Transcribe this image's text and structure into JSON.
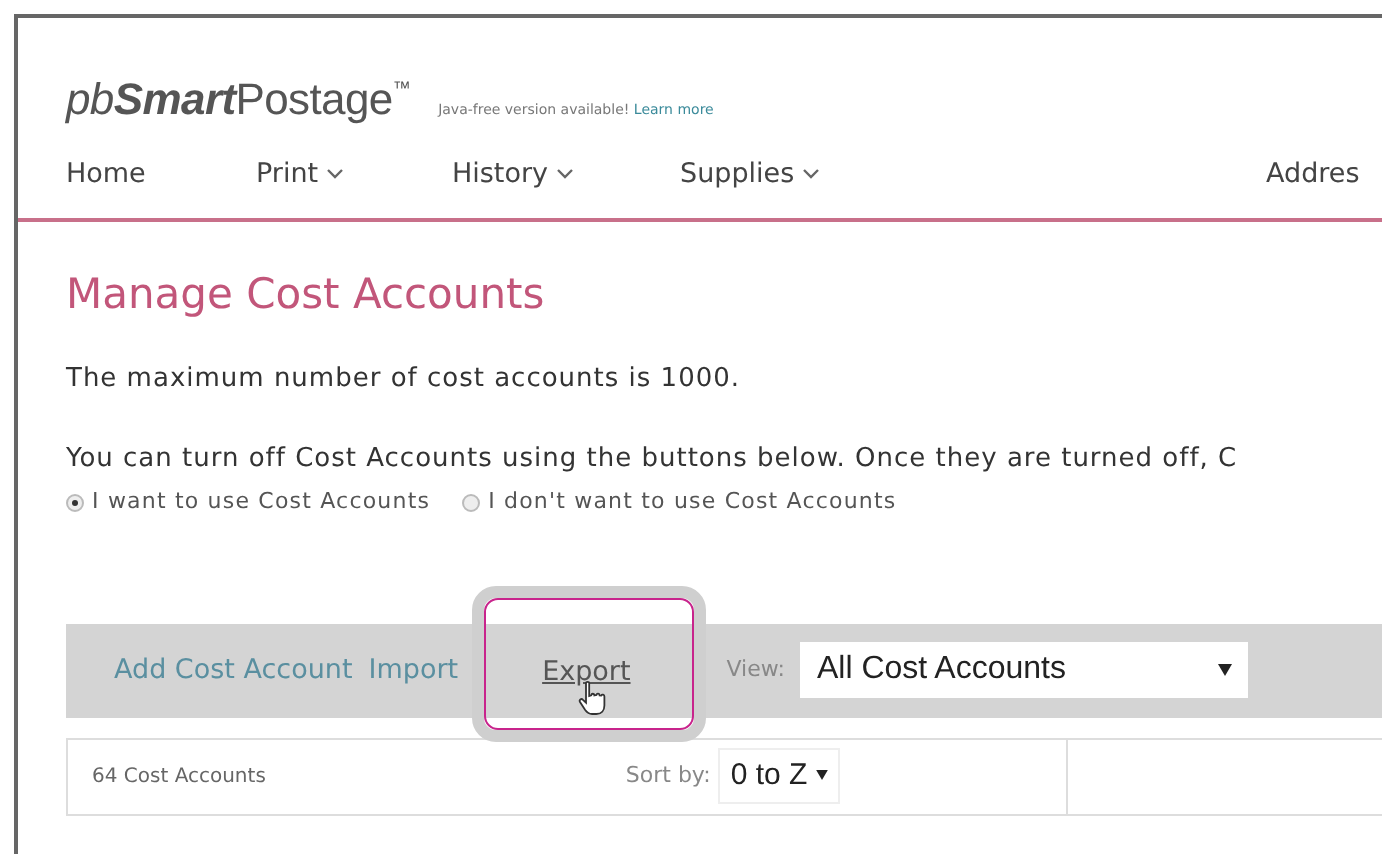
{
  "header": {
    "logo_prefix": "pb",
    "logo_bold": "Smart",
    "logo_suffix": "Postage",
    "logo_mark": "™",
    "notice": "Java-free version available!",
    "notice_link": "Learn more"
  },
  "nav": [
    {
      "label": "Home",
      "dropdown": false
    },
    {
      "label": "Print",
      "dropdown": true
    },
    {
      "label": "History",
      "dropdown": true
    },
    {
      "label": "Supplies",
      "dropdown": true
    },
    {
      "label": "Addres",
      "dropdown": false
    }
  ],
  "title": "Manage Cost Accounts",
  "paragraphs": [
    "The maximum number of cost accounts is 1000.",
    "You can turn off Cost Accounts using the buttons below. Once they are turned off, C"
  ],
  "options": [
    {
      "label": "I want to use Cost Accounts",
      "selected": true
    },
    {
      "label": "I don't want to use Cost Accounts",
      "selected": false
    }
  ],
  "toolbar": {
    "links": [
      {
        "label": "Add Cost Account",
        "highlighted": false
      },
      {
        "label": "Import",
        "highlighted": false
      },
      {
        "label": "Export",
        "highlighted": true
      }
    ],
    "view_label": "View:",
    "view_value": "All Cost Accounts"
  },
  "table": {
    "count": "64 Cost Accounts",
    "sort_label": "Sort by:",
    "sort_value": "0 to Z"
  }
}
